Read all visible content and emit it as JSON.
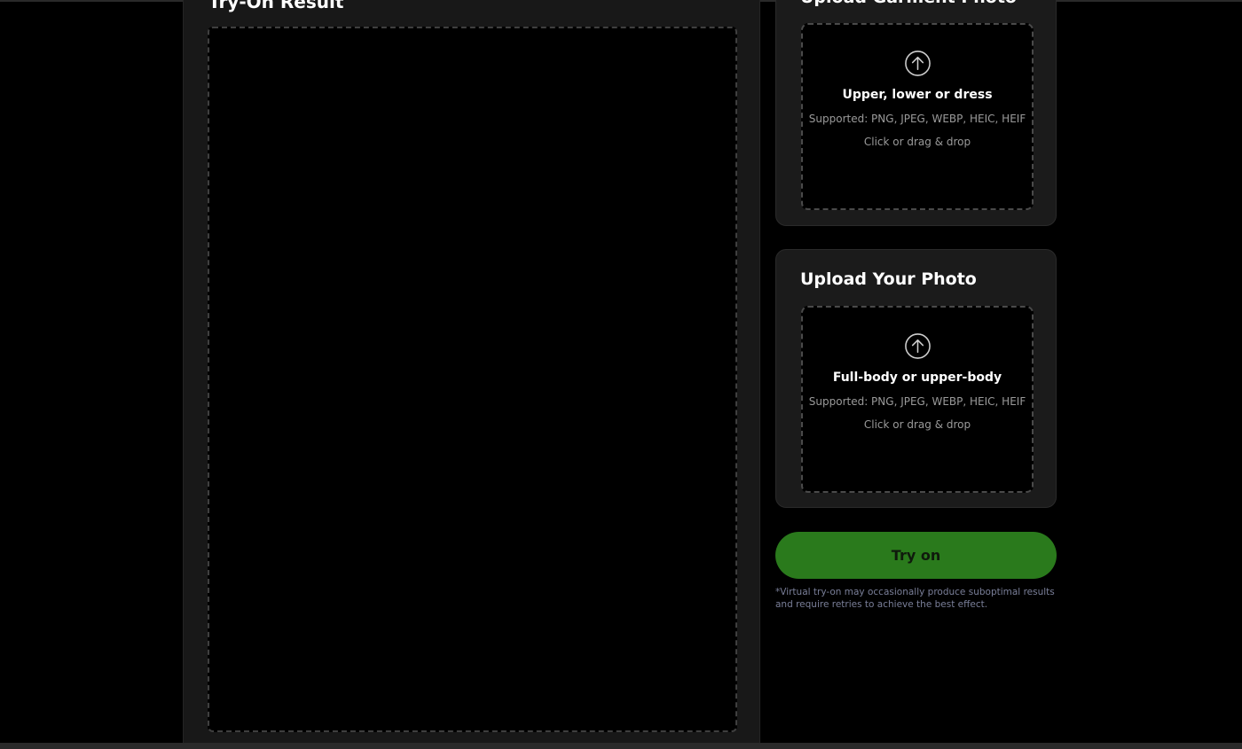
{
  "result": {
    "title": "Try-On Result"
  },
  "garment_card": {
    "title": "Upload Garment Photo",
    "main_text": "Upper, lower or dress",
    "supported": "Supported: PNG, JPEG, WEBP, HEIC, HEIF",
    "hint": "Click or drag & drop",
    "icon": "upload-arrow-icon"
  },
  "photo_card": {
    "title": "Upload Your Photo",
    "main_text": "Full-body or upper-body",
    "supported": "Supported: PNG, JPEG, WEBP, HEIC, HEIF",
    "hint": "Click or drag & drop",
    "icon": "upload-arrow-icon"
  },
  "try_on": {
    "label": "Try on"
  },
  "disclaimer": "*Virtual try-on may occasionally produce suboptimal results and require retries to achieve the best effect.",
  "colors": {
    "background": "#000000",
    "panel": "#181818",
    "card": "#1b1b1b",
    "accent_green": "#2a7a1c",
    "muted_text": "#9a9a9a",
    "disclaimer_text": "#7a7f99"
  }
}
